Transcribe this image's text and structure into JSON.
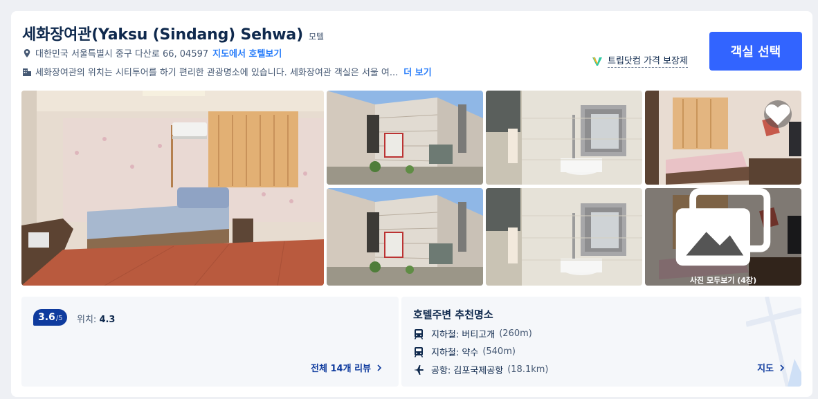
{
  "hotel": {
    "name": "세화장여관(Yaksu (Sindang) Sehwa)",
    "type": "모텔",
    "address": "대한민국 서울특별시 중구 다산로 66, 04597",
    "map_link": "지도에서 호텔보기",
    "description": "세화장여관의 위치는 시티투어를 하기 편리한 관광명소에 있습니다. 세화장여관 객실은 서울 여...",
    "more_link": "더 보기"
  },
  "guarantee": {
    "label": "트립닷컴 가격 보장제"
  },
  "select_button": {
    "label": "객실 선택"
  },
  "gallery": {
    "all_photos_label": "사진 모두보기 (4장)"
  },
  "rating": {
    "score": "3.6",
    "max": "/5",
    "location_label": "위치:",
    "location_score": "4.3",
    "reviews_link": "전체 14개 리뷰"
  },
  "nearby": {
    "title": "호텔주변 추천명소",
    "items": [
      {
        "icon": "subway-icon",
        "label": "지하철: 버티고개",
        "distance": "(260m)"
      },
      {
        "icon": "subway-icon",
        "label": "지하철: 약수",
        "distance": "(540m)"
      },
      {
        "icon": "airplane-icon",
        "label": "공항: 김포국제공항",
        "distance": "(18.1km)"
      }
    ],
    "map_link": "지도"
  },
  "colors": {
    "primary": "#3264ff",
    "link": "#287dfa",
    "score_badge": "#0f3b9e",
    "text": "#0f294d"
  }
}
